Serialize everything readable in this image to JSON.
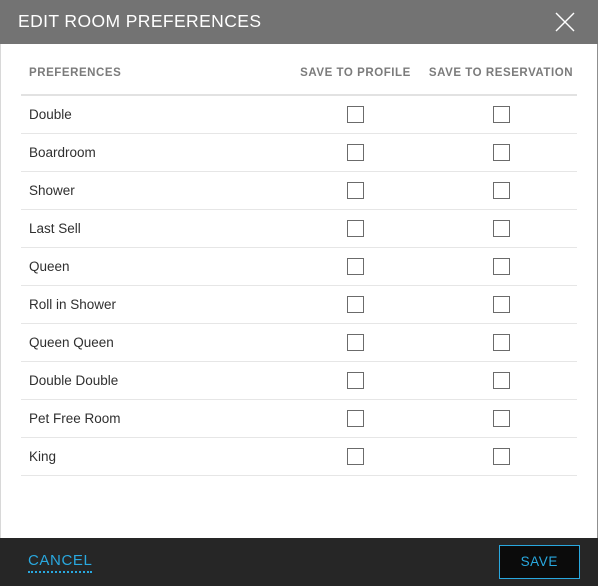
{
  "dialog": {
    "title": "EDIT ROOM PREFERENCES",
    "close_icon": "close-icon",
    "accent_color": "#29a8df",
    "titlebar_color": "#737373",
    "footer_color": "#262626"
  },
  "table": {
    "headers": {
      "name": "PREFERENCES",
      "save_to_profile": "SAVE TO PROFILE",
      "save_to_reservation": "SAVE TO RESERVATION"
    },
    "rows": [
      {
        "name": "Double",
        "save_to_profile": false,
        "save_to_reservation": false
      },
      {
        "name": "Boardroom",
        "save_to_profile": false,
        "save_to_reservation": false
      },
      {
        "name": "Shower",
        "save_to_profile": false,
        "save_to_reservation": false
      },
      {
        "name": "Last Sell",
        "save_to_profile": false,
        "save_to_reservation": false
      },
      {
        "name": "Queen",
        "save_to_profile": false,
        "save_to_reservation": false
      },
      {
        "name": "Roll in Shower",
        "save_to_profile": false,
        "save_to_reservation": false
      },
      {
        "name": "Queen Queen",
        "save_to_profile": false,
        "save_to_reservation": false
      },
      {
        "name": "Double Double",
        "save_to_profile": false,
        "save_to_reservation": false
      },
      {
        "name": "Pet Free Room",
        "save_to_profile": false,
        "save_to_reservation": false
      },
      {
        "name": "King",
        "save_to_profile": false,
        "save_to_reservation": false
      }
    ]
  },
  "footer": {
    "cancel_label": "CANCEL",
    "save_label": "SAVE"
  }
}
